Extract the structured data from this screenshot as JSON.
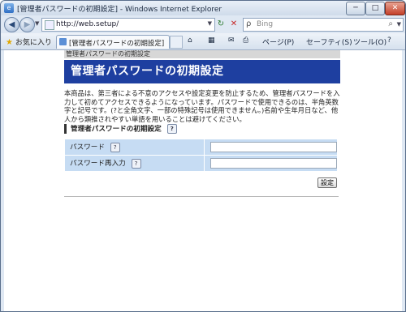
{
  "window": {
    "title": "[管理者パスワードの初期設定] - Windows Internet Explorer",
    "app_icon": "ie-icon",
    "buttons": {
      "minimize": "─",
      "maximize": "□",
      "close": "✕"
    }
  },
  "address_bar": {
    "url": "http://web.setup/",
    "back_glyph": "◀",
    "forward_glyph": "▶",
    "refresh_glyph": "↻",
    "stop_glyph": "✕"
  },
  "search_bar": {
    "placeholder": "Bing",
    "glyph": "⌕"
  },
  "favorites": {
    "label": "お気に入り",
    "star": "★"
  },
  "tab": {
    "label": "[管理者パスワードの初期設定]"
  },
  "command_bar": {
    "home": "⌂",
    "feeds": "▦",
    "mail": "✉",
    "print": "⎙",
    "page": "ページ(P)",
    "safety": "セーフティ(S)",
    "tools": "ツール(O)",
    "help": "?"
  },
  "page": {
    "breadcrumb": "管理者パスワードの初期設定",
    "banner_title": "管理者パスワードの初期設定",
    "intro": "本商品は、第三者による不意のアクセスや設定変更を防止するため、管理者パスワードを入力して初めてアクセスできるようになっています。パスワードで使用できるのは、半角英数字と記号です。(?と全角文字、一部の特殊記号は使用できません。)名前や生年月日など、他人から類推されやすい単語を用いることは避けてください。",
    "section_title": "管理者パスワードの初期設定",
    "help_glyph": "?",
    "fields": [
      {
        "label": "パスワード",
        "value": ""
      },
      {
        "label": "パスワード再入力",
        "value": ""
      }
    ],
    "submit_label": "設定"
  }
}
